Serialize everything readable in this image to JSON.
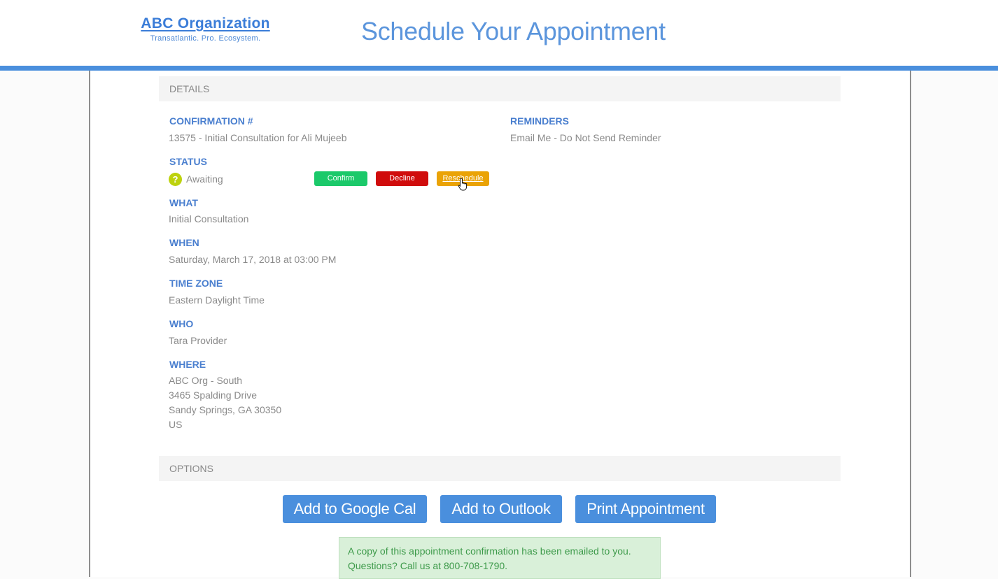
{
  "header": {
    "logo_name": "ABC Organization",
    "logo_tagline": "Transatlantic. Pro. Ecosystem.",
    "title": "Schedule Your Appointment"
  },
  "details": {
    "section_title": "DETAILS",
    "confirmation_label": "CONFIRMATION #",
    "confirmation_value": "13575 - Initial Consultation for Ali Mujeeb",
    "reminders_label": "REMINDERS",
    "reminders_value": "Email Me - Do Not Send Reminder",
    "status_label": "STATUS",
    "status_icon": "?",
    "status_value": "Awaiting",
    "what_label": "WHAT",
    "what_value": "Initial Consultation",
    "when_label": "WHEN",
    "when_value": "Saturday, March 17, 2018 at 03:00 PM",
    "timezone_label": "TIME ZONE",
    "timezone_value": "Eastern Daylight Time",
    "who_label": "WHO",
    "who_value": "Tara Provider",
    "where_label": "WHERE",
    "where_lines": [
      "ABC Org - South",
      "3465 Spalding Drive",
      "Sandy Springs, GA 30350",
      "US"
    ]
  },
  "status_actions": {
    "confirm": "Confirm",
    "decline": "Decline",
    "reschedule": "Reschedule"
  },
  "options": {
    "section_title": "OPTIONS",
    "google": "Add to Google Cal",
    "outlook": "Add to Outlook",
    "print": "Print Appointment"
  },
  "notice": {
    "line1": "A copy of this appointment confirmation has been emailed to you.",
    "line2": "Questions? Call us at 800-708-1790."
  },
  "colors": {
    "brand_blue": "#4a8fdd",
    "confirm_green": "#1bc96a",
    "decline_red": "#d00c0c",
    "reschedule_orange": "#eaa306",
    "awaiting_yellow": "#bdd20e"
  }
}
